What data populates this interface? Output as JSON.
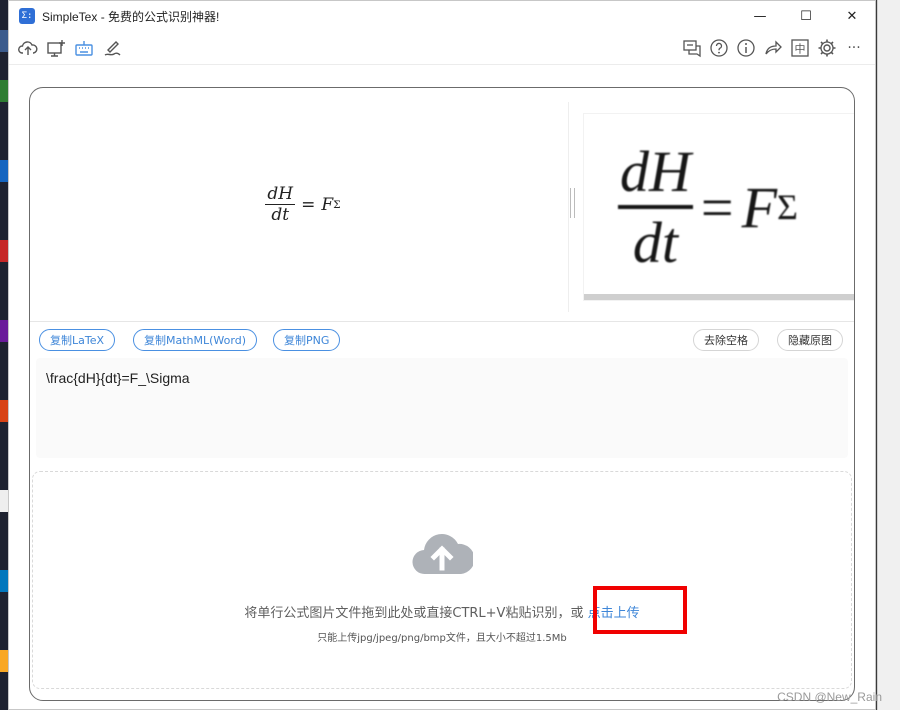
{
  "window": {
    "title": "SimpleTex - 免费的公式识别神器!",
    "app_icon_glyph": "Σ:",
    "controls": {
      "minimize": "—",
      "maximize": "☐",
      "close": "✕"
    }
  },
  "toolbar": {
    "left_icons": [
      "cloud-upload-icon",
      "screen-capture-icon",
      "keyboard-icon",
      "handwriting-icon"
    ],
    "right_icons": [
      "chat-icon",
      "help-icon",
      "info-icon",
      "share-icon",
      "chinese-lang-icon",
      "settings-icon",
      "more-icon"
    ],
    "lang_glyph": "中",
    "more_glyph": "···",
    "accent_color": "#4a90e2"
  },
  "preview": {
    "numerator": "dH",
    "denominator": "dt",
    "equals": "=",
    "rhs": "F",
    "subscript": "Σ"
  },
  "original_image": {
    "numerator": "dH",
    "denominator": "dt",
    "equals": "=",
    "rhs": "F",
    "subscript": "Σ"
  },
  "actions": {
    "copy_latex": "复制LaTeX",
    "copy_mathml": "复制MathML(Word)",
    "copy_png": "复制PNG",
    "remove_spaces": "去除空格",
    "hide_original": "隐藏原图"
  },
  "latex": {
    "value": "\\frac{dH}{dt}=F_\\Sigma"
  },
  "upload": {
    "instruction": "将单行公式图片文件拖到此处或直接CTRL+V粘贴识别，或 ",
    "link": "点击上传",
    "hint": "只能上传jpg/jpeg/png/bmp文件，且大小不超过1.5Mb",
    "highlight_color": "#f00000"
  },
  "watermark": "CSDN @New_Rain"
}
